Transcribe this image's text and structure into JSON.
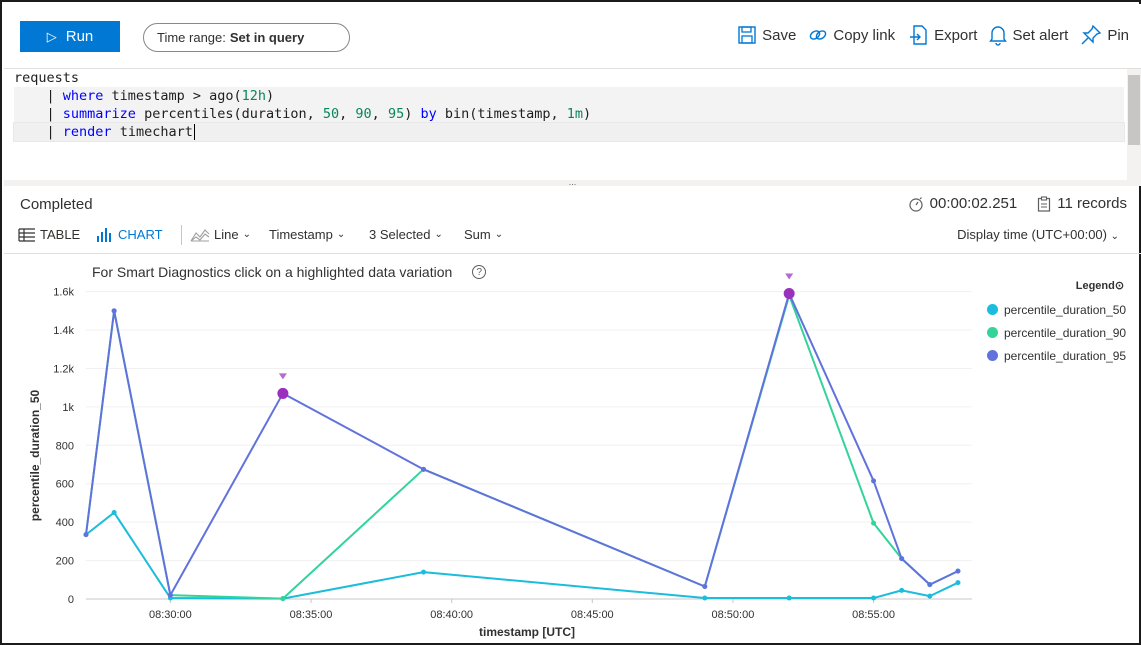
{
  "toolbar": {
    "run_label": "Run",
    "time_range_label": "Time range:",
    "time_range_value": "Set in query",
    "save_label": "Save",
    "copy_link_label": "Copy link",
    "export_label": "Export",
    "set_alert_label": "Set alert",
    "pin_label": "Pin"
  },
  "editor": {
    "line1": "requests",
    "line2_kw": "where",
    "line2_rest": " timestamp > ago(",
    "line2_num": "12h",
    "line2_end": ")",
    "line3_kw": "summarize",
    "line3_rest": " percentiles(duration, ",
    "line3_n1": "50",
    "line3_c1": ", ",
    "line3_n2": "90",
    "line3_c2": ", ",
    "line3_n3": "95",
    "line3_mid": ") ",
    "line3_by": "by",
    "line3_bin": " bin(timestamp, ",
    "line3_n4": "1m",
    "line3_end": ")",
    "line4_kw": "render",
    "line4_rest": " timechart",
    "splitter_label": "..."
  },
  "status": {
    "state": "Completed",
    "duration": "00:00:02.251",
    "records": "11 records"
  },
  "chart_tools": {
    "table_tab": "TABLE",
    "chart_tab": "CHART",
    "chart_type": "Line",
    "x_column": "Timestamp",
    "y_columns": "3 Selected",
    "aggregation": "Sum",
    "display_time": "Display time (UTC+00:00)"
  },
  "chart_note": "For Smart Diagnostics click on a highlighted data variation",
  "colors": {
    "accent": "#0078d4",
    "p50": "#1bbcdc",
    "p90": "#33d49a",
    "p95": "#6272dd",
    "anomaly": "#9b2fbe"
  },
  "chart_data": {
    "type": "line",
    "title": "",
    "xlabel": "timestamp [UTC]",
    "ylabel": "percentile_duration_50",
    "x_ticks": [
      "08:30:00",
      "08:35:00",
      "08:40:00",
      "08:45:00",
      "08:50:00",
      "08:55:00"
    ],
    "y_ticks": [
      "0",
      "200",
      "400",
      "600",
      "800",
      "1k",
      "1.2k",
      "1.4k",
      "1.6k"
    ],
    "ylim": [
      0,
      1650
    ],
    "xlim": [
      "08:27:00",
      "08:58:30"
    ],
    "legend_title": "Legend",
    "legend_position": "top-right",
    "x": [
      "08:27:00",
      "08:28:00",
      "08:30:00",
      "08:34:00",
      "08:39:00",
      "08:49:00",
      "08:52:00",
      "08:55:00",
      "08:56:00",
      "08:57:00",
      "08:58:00"
    ],
    "series": [
      {
        "name": "percentile_duration_50",
        "values": [
          335,
          450,
          5,
          2,
          140,
          5,
          5,
          5,
          45,
          15,
          85
        ]
      },
      {
        "name": "percentile_duration_90",
        "values": [
          335,
          1500,
          20,
          2,
          675,
          65,
          1580,
          395,
          210,
          75,
          145
        ]
      },
      {
        "name": "percentile_duration_95",
        "values": [
          335,
          1500,
          20,
          1070,
          675,
          65,
          1590,
          615,
          210,
          75,
          145
        ]
      }
    ],
    "anomalies": [
      {
        "x": "08:34:00",
        "series": "percentile_duration_95",
        "value": 1070
      },
      {
        "x": "08:52:00",
        "series": "percentile_duration_95",
        "value": 1590
      }
    ]
  }
}
